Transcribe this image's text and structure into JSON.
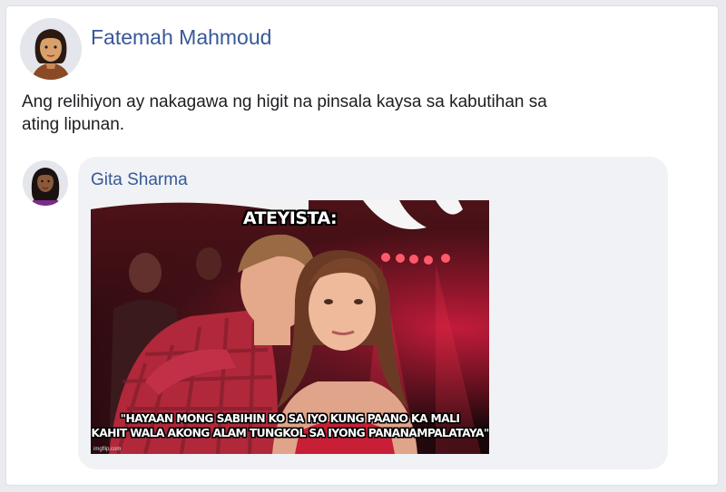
{
  "post": {
    "author": "Fatemah Mahmoud",
    "text": "Ang relihiyon ay nakagawa ng higit na pinsala kaysa sa kabutihan sa ating lipunan.",
    "avatar_icon": "female-avatar-icon"
  },
  "reply": {
    "author": "Gita Sharma",
    "avatar_icon": "female-avatar-icon",
    "meme": {
      "top_text": "ATEYISTA:",
      "bottom_line_1": "\"HAYAAN MONG SABIHIN KO SA IYO KUNG PAANO KA MALI",
      "bottom_line_2": "KAHIT WALA AKONG ALAM TUNGKOL SA IYONG PANANAMPALATAYA\"",
      "watermark": "imgflip.com"
    }
  },
  "colors": {
    "name_link": "#385898",
    "bubble_bg": "#f0f2f5",
    "page_bg": "#e9ebee"
  }
}
